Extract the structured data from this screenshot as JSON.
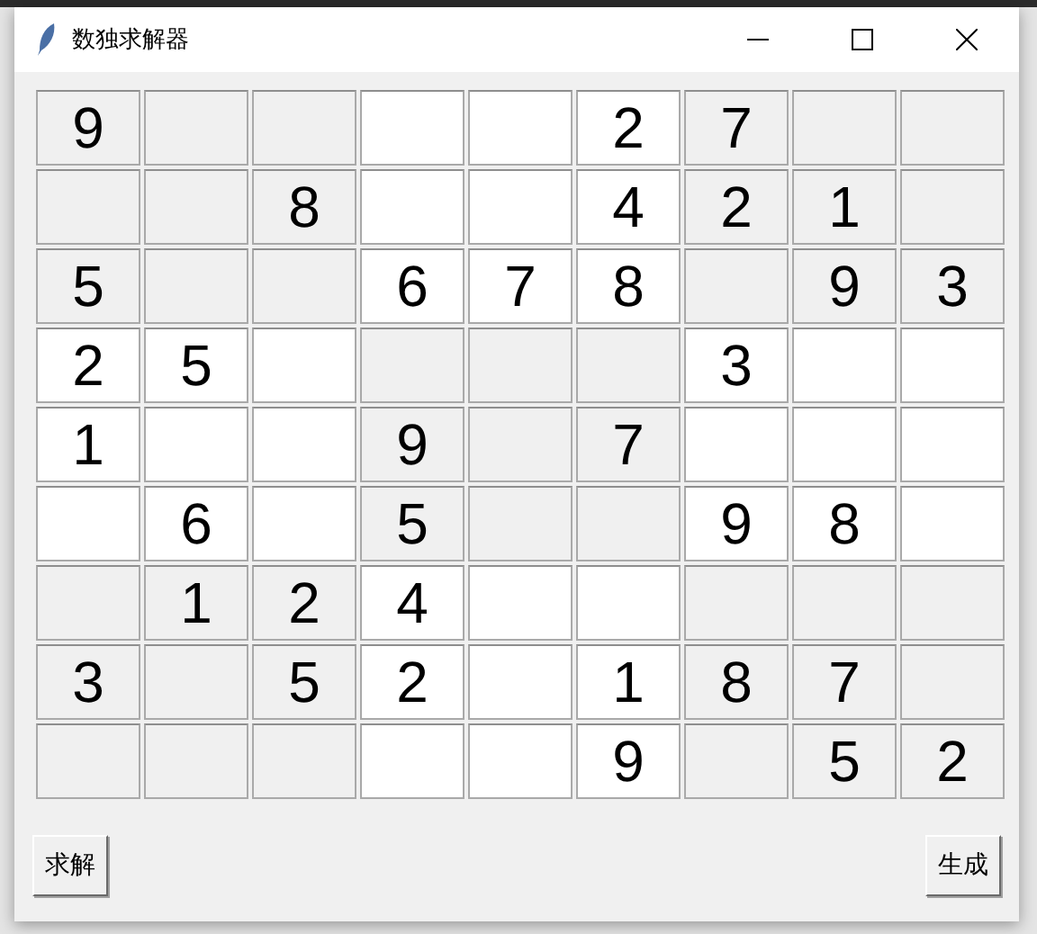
{
  "window": {
    "title": "数独求解器"
  },
  "grid": [
    [
      {
        "kind": "digit",
        "value": "9"
      },
      {
        "kind": "blank"
      },
      {
        "kind": "blank"
      },
      {
        "kind": "blank"
      },
      {
        "kind": "blank"
      },
      {
        "kind": "digit",
        "value": "2"
      },
      {
        "kind": "digit",
        "value": "7"
      },
      {
        "kind": "blank"
      },
      {
        "kind": "blank"
      }
    ],
    [
      {
        "kind": "blank"
      },
      {
        "kind": "blank"
      },
      {
        "kind": "digit",
        "value": "8"
      },
      {
        "kind": "blank"
      },
      {
        "kind": "blank"
      },
      {
        "kind": "digit",
        "value": "4"
      },
      {
        "kind": "digit",
        "value": "2"
      },
      {
        "kind": "digit",
        "value": "1"
      },
      {
        "kind": "blank"
      }
    ],
    [
      {
        "kind": "digit",
        "value": "5"
      },
      {
        "kind": "blank"
      },
      {
        "kind": "blank"
      },
      {
        "kind": "digit",
        "value": "6"
      },
      {
        "kind": "digit",
        "value": "7"
      },
      {
        "kind": "digit",
        "value": "8"
      },
      {
        "kind": "blank"
      },
      {
        "kind": "digit",
        "value": "9"
      },
      {
        "kind": "digit",
        "value": "3"
      }
    ],
    [
      {
        "kind": "digit",
        "value": "2"
      },
      {
        "kind": "digit",
        "value": "5"
      },
      {
        "kind": "blank"
      },
      {
        "kind": "blank"
      },
      {
        "kind": "blank"
      },
      {
        "kind": "blank"
      },
      {
        "kind": "digit",
        "value": "3"
      },
      {
        "kind": "blank"
      },
      {
        "kind": "blank"
      }
    ],
    [
      {
        "kind": "digit",
        "value": "1"
      },
      {
        "kind": "blank"
      },
      {
        "kind": "blank"
      },
      {
        "kind": "digit",
        "value": "9"
      },
      {
        "kind": "blank"
      },
      {
        "kind": "digit",
        "value": "7"
      },
      {
        "kind": "blank"
      },
      {
        "kind": "blank"
      },
      {
        "kind": "blank"
      }
    ],
    [
      {
        "kind": "blank"
      },
      {
        "kind": "digit",
        "value": "6"
      },
      {
        "kind": "blank"
      },
      {
        "kind": "digit",
        "value": "5"
      },
      {
        "kind": "blank"
      },
      {
        "kind": "blank"
      },
      {
        "kind": "digit",
        "value": "9"
      },
      {
        "kind": "digit",
        "value": "8"
      },
      {
        "kind": "blank"
      }
    ],
    [
      {
        "kind": "blank"
      },
      {
        "kind": "digit",
        "value": "1"
      },
      {
        "kind": "digit",
        "value": "2"
      },
      {
        "kind": "digit",
        "value": "4"
      },
      {
        "kind": "blank"
      },
      {
        "kind": "blank"
      },
      {
        "kind": "blank"
      },
      {
        "kind": "blank"
      },
      {
        "kind": "blank"
      }
    ],
    [
      {
        "kind": "digit",
        "value": "3"
      },
      {
        "kind": "blank"
      },
      {
        "kind": "digit",
        "value": "5"
      },
      {
        "kind": "digit",
        "value": "2"
      },
      {
        "kind": "blank"
      },
      {
        "kind": "digit",
        "value": "1"
      },
      {
        "kind": "digit",
        "value": "8"
      },
      {
        "kind": "digit",
        "value": "7"
      },
      {
        "kind": "blank"
      }
    ],
    [
      {
        "kind": "blank"
      },
      {
        "kind": "blank"
      },
      {
        "kind": "blank"
      },
      {
        "kind": "blank"
      },
      {
        "kind": "blank"
      },
      {
        "kind": "digit",
        "value": "9"
      },
      {
        "kind": "blank"
      },
      {
        "kind": "digit",
        "value": "5"
      },
      {
        "kind": "digit",
        "value": "2"
      }
    ]
  ],
  "buttons": [
    "求解",
    "生成"
  ]
}
